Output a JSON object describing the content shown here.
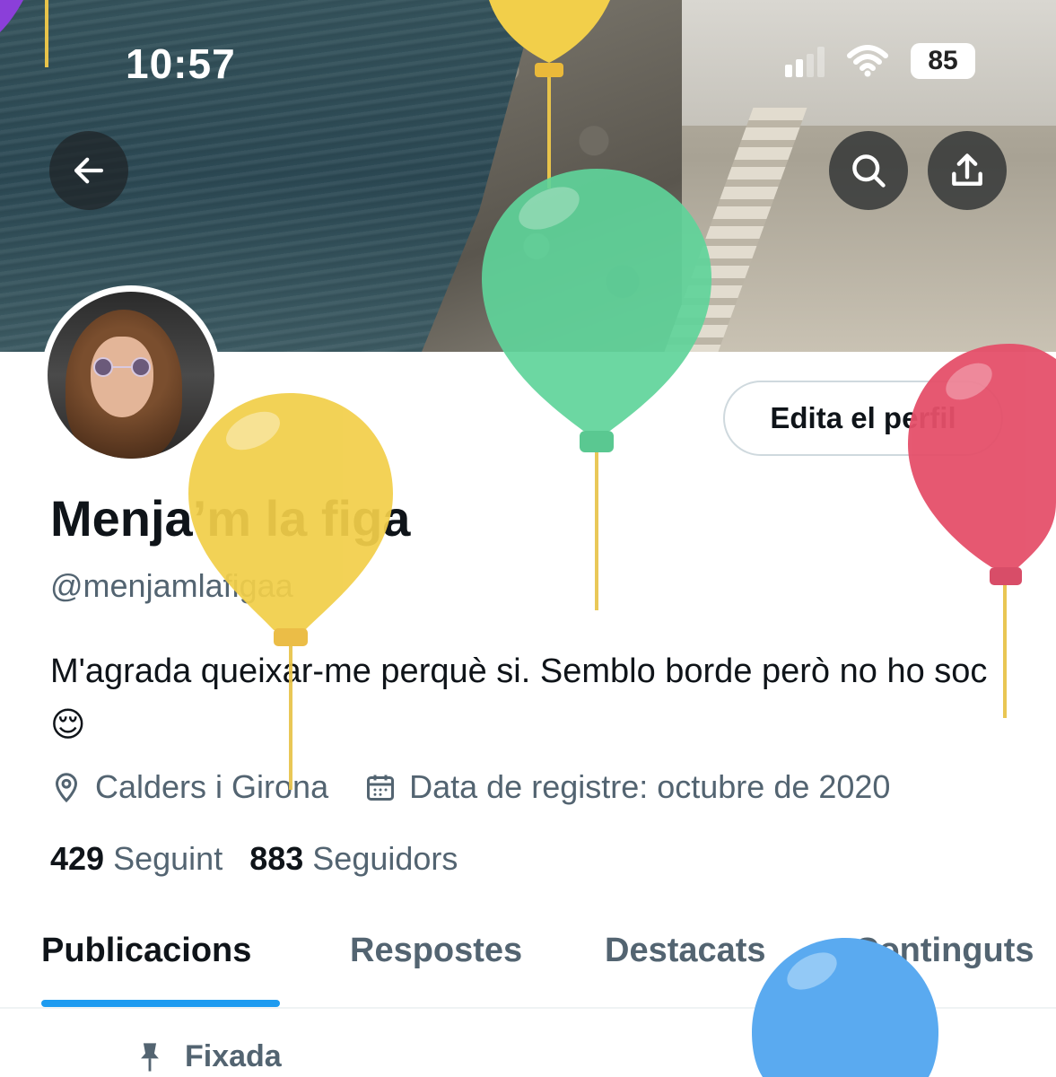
{
  "status_bar": {
    "time": "10:57",
    "battery": "85"
  },
  "header": {
    "back_icon": "arrow-left-icon",
    "search_icon": "search-icon",
    "share_icon": "share-icon"
  },
  "profile": {
    "edit_button_label": "Edita el perfil",
    "display_name": "Menja’m la figa",
    "handle": "@menjamlafigaa",
    "bio": "M'agrada queixar-me perquè si. Semblo borde però no ho soc😌",
    "location": "Calders i Girona",
    "joined": "Data de registre: octubre de 2020",
    "following_count": "429",
    "following_label": "Seguint",
    "followers_count": "883",
    "followers_label": "Seguidors"
  },
  "tabs": [
    {
      "label": "Publicacions",
      "active": true
    },
    {
      "label": "Respostes",
      "active": false
    },
    {
      "label": "Destacats",
      "active": false
    },
    {
      "label": "Continguts",
      "active": false
    }
  ],
  "pinned": {
    "label": "Fixada",
    "icon": "pin-icon"
  },
  "colors": {
    "accent": "#1d9bf0",
    "text_primary": "#0f1419",
    "text_secondary": "#536471",
    "balloon_yellow": "#f2cf4a",
    "balloon_green": "#5fd49a",
    "balloon_red": "#e5506a",
    "balloon_blue": "#5aaaf0"
  }
}
